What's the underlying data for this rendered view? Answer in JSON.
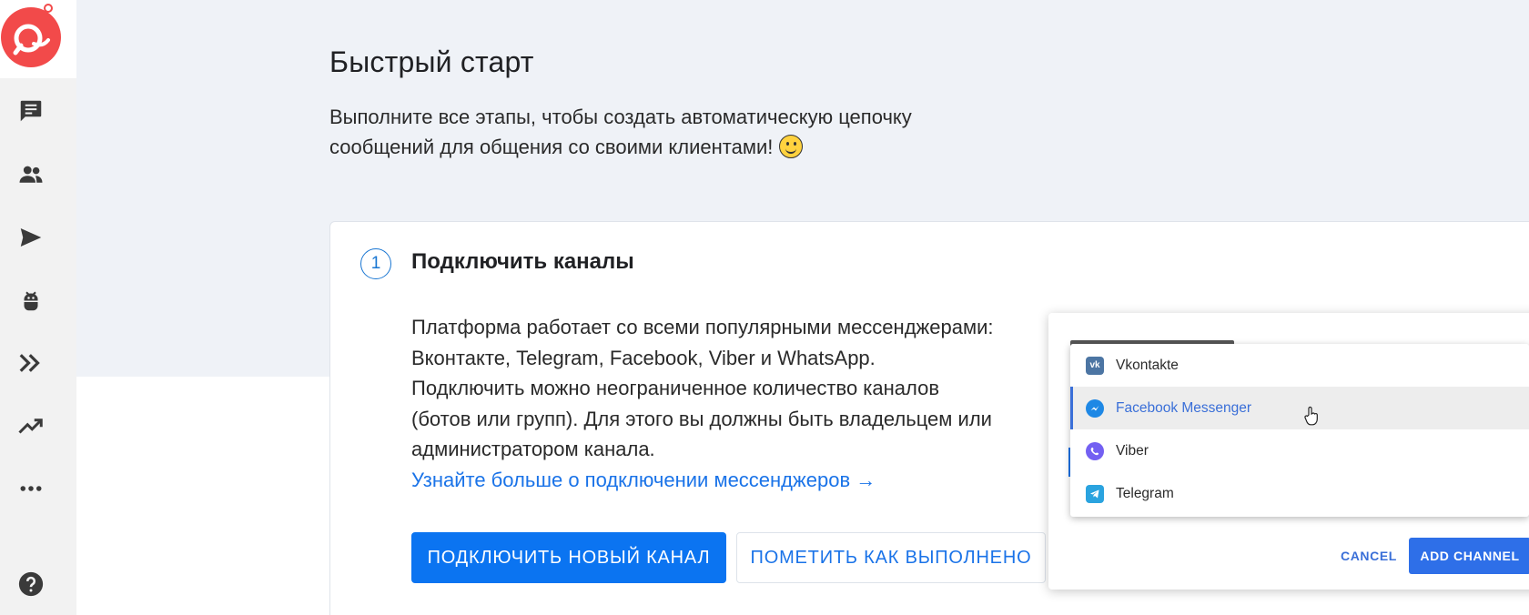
{
  "sidebar": {
    "logo": "pravo-logo-icon",
    "items": [
      {
        "name": "chat-icon",
        "label": ""
      },
      {
        "name": "users-icon",
        "label": ""
      },
      {
        "name": "send-icon",
        "label": ""
      },
      {
        "name": "android-bot-icon",
        "label": ""
      },
      {
        "name": "double-chevron-icon",
        "label": ""
      },
      {
        "name": "trending-up-icon",
        "label": ""
      },
      {
        "name": "more-dots-icon",
        "label": ""
      }
    ],
    "help": "help-icon"
  },
  "hero": {
    "title": "Быстрый старт",
    "subtitle": "Выполните все этапы, чтобы создать автоматическую цепочку сообщений для общения со своими клиентами!"
  },
  "step": {
    "number": "1",
    "title": "Подключить каналы",
    "description": "Платформа работает со всеми популярными мессенджерами: Вконтакте, Telegram, Facebook, Viber и WhatsApp. Подключить можно неограниченное количество каналов (ботов или групп). Для этого вы должны быть владельцем или администратором канала.",
    "link": "Узнайте больше о подключении мессенджеров →",
    "primary_button": "ПОДКЛЮЧИТЬ НОВЫЙ КАНАЛ",
    "secondary_button": "ПОМЕТИТЬ КАК ВЫПОЛНЕНО"
  },
  "dialog": {
    "options": [
      {
        "label": "Vkontakte",
        "icon": "vk-icon"
      },
      {
        "label": "Facebook Messenger",
        "icon": "messenger-icon",
        "selected": true
      },
      {
        "label": "Viber",
        "icon": "viber-icon"
      },
      {
        "label": "Telegram",
        "icon": "telegram-icon"
      }
    ],
    "cancel": "CANCEL",
    "add": "ADD CHANNEL"
  },
  "colors": {
    "accent": "#0b74f1",
    "logo": "#f24a4a",
    "hero_bg": "#eff2f7",
    "sidebar_bg": "#f2f2f2"
  }
}
